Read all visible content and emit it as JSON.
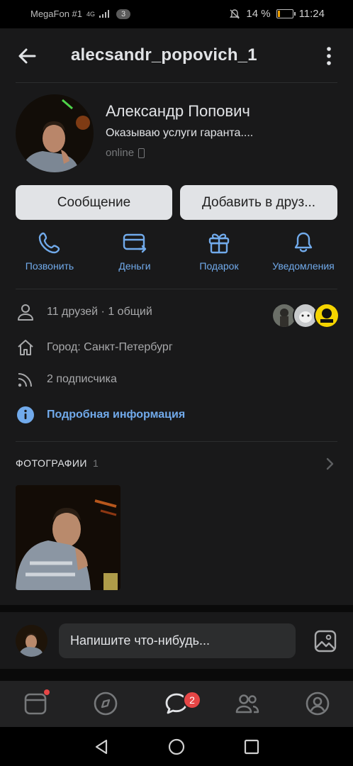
{
  "status_bar": {
    "carrier": "MegaFon #1",
    "signal_text": "4G",
    "sim_badge": "3",
    "battery_text": "14 %",
    "battery_level": 0.14,
    "time": "11:24"
  },
  "header": {
    "title": "alecsandr_popovich_1"
  },
  "profile": {
    "name": "Александр Попович",
    "status": "Оказываю услуги гаранта....",
    "online": "online"
  },
  "buttons": {
    "message": "Сообщение",
    "add_friend": "Добавить в друз..."
  },
  "actions": [
    {
      "label": "Позвонить",
      "icon": "phone-icon"
    },
    {
      "label": "Деньги",
      "icon": "money-transfer-icon"
    },
    {
      "label": "Подарок",
      "icon": "gift-icon"
    },
    {
      "label": "Уведомления",
      "icon": "bell-icon"
    }
  ],
  "info": {
    "friends": "11 друзей · 1 общий",
    "city": "Город: Санкт-Петербург",
    "followers": "2 подписчика",
    "details_link": "Подробная информация"
  },
  "photos": {
    "label": "ФОТОГРАФИИ",
    "count": "1"
  },
  "composer": {
    "placeholder": "Напишите что-нибудь..."
  },
  "tabbar": {
    "messages_badge": "2"
  },
  "colors": {
    "background": "#19191a",
    "accent": "#71aaeb",
    "badge": "#e64646",
    "button_bg": "#e1e3e6"
  }
}
